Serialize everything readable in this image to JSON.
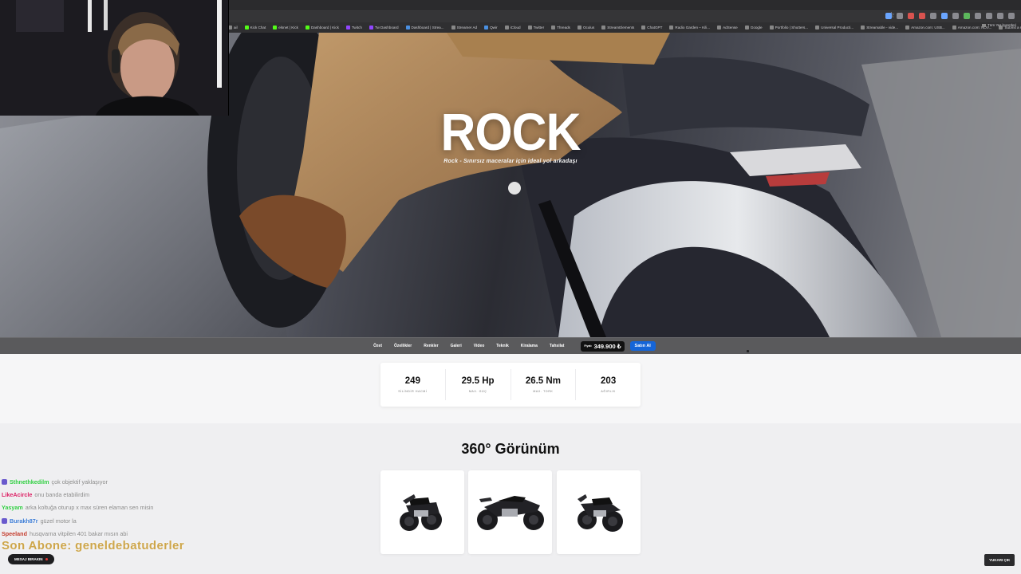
{
  "bookmarks": [
    {
      "label": "ail",
      "kind": "plain"
    },
    {
      "label": "Kick Chat",
      "kind": "g"
    },
    {
      "label": "elsnet | Kick",
      "kind": "g"
    },
    {
      "label": "Dashboard | Kick",
      "kind": "g"
    },
    {
      "label": "Twitch",
      "kind": "p"
    },
    {
      "label": "Tw Dashboard",
      "kind": "p"
    },
    {
      "label": "Dashboard | Strea...",
      "kind": "b"
    },
    {
      "label": "Streamer Ad",
      "kind": "plain"
    },
    {
      "label": "Qwir",
      "kind": "b"
    },
    {
      "label": "iCloud",
      "kind": "plain"
    },
    {
      "label": "Twitter",
      "kind": "plain"
    },
    {
      "label": "Threads",
      "kind": "plain"
    },
    {
      "label": "Oculus",
      "kind": "plain"
    },
    {
      "label": "StreamElements",
      "kind": "plain"
    },
    {
      "label": "ChatGPT",
      "kind": "plain"
    },
    {
      "label": "Radio Garden – Kili...",
      "kind": "plain"
    },
    {
      "label": "AdSense",
      "kind": "plain"
    },
    {
      "label": "Google",
      "kind": "plain"
    },
    {
      "label": "Portfolio | Shutters...",
      "kind": "plain"
    },
    {
      "label": "Universal Producti...",
      "kind": "plain"
    },
    {
      "label": "Streamable - vide...",
      "kind": "plain"
    },
    {
      "label": "Amazon.com: USB...",
      "kind": "plain"
    },
    {
      "label": "Amazon.com: NOV...",
      "kind": "plain"
    },
    {
      "label": "Submit a request...",
      "kind": "plain"
    },
    {
      "label": "Drive & Listen",
      "kind": "plain"
    }
  ],
  "bookmarks_other": "Tüm Yer İşaretleri",
  "hero": {
    "title": "ROCK",
    "subtitle": "Rock - Sınırsız maceralar için ideal yol arkadaşı"
  },
  "nav": {
    "links": [
      "Özet",
      "Özellikler",
      "Renkler",
      "Galeri",
      "Video",
      "Teknik",
      "Kiralama",
      "Tahsilat"
    ],
    "price_label": "Fiyatı",
    "price_value": "349.900 ₺",
    "buy_label": "Satın Al"
  },
  "specs": [
    {
      "value": "249",
      "label": "SİLİNDİR HACMİ"
    },
    {
      "value": "29.5 Hp",
      "label": "MAX. GÜÇ"
    },
    {
      "value": "26.5 Nm",
      "label": "MAX. TORK"
    },
    {
      "value": "203",
      "label": "AĞIRLIK"
    }
  ],
  "view360": {
    "title": "360° Görünüm",
    "tiles": [
      "motorcycle-front-three-quarter",
      "motorcycle-side",
      "motorcycle-rear-three-quarter"
    ]
  },
  "chat": [
    {
      "user": "Sthnethkedilm",
      "message": "çok objektif yaklaşıyor",
      "color": "#2ecc40",
      "badge": true
    },
    {
      "user": "LikeAcircle",
      "message": "onu banda etabilirdim",
      "color": "#d81b60",
      "badge": false
    },
    {
      "user": "Yasyam",
      "message": "arka koltuğa oturup x max süren elaman sen misin",
      "color": "#2ecc40",
      "badge": false
    },
    {
      "user": "Burakh87r",
      "message": "güzel motor la",
      "color": "#3a7bd5",
      "badge": true
    },
    {
      "user": "Speeland",
      "message": "husqvarna vitpilen 401 bakar mısın abi",
      "color": "#c0392b",
      "badge": false
    }
  ],
  "latest_sub": "Son Abone: geneldebatuderler",
  "leave_message": "MESAJ BIRAKIN",
  "to_top": "YUKARI ÇIK",
  "colors": {
    "accent": "#1565d8",
    "nav": "#5a5a5c",
    "sub": "#c99a2e"
  }
}
